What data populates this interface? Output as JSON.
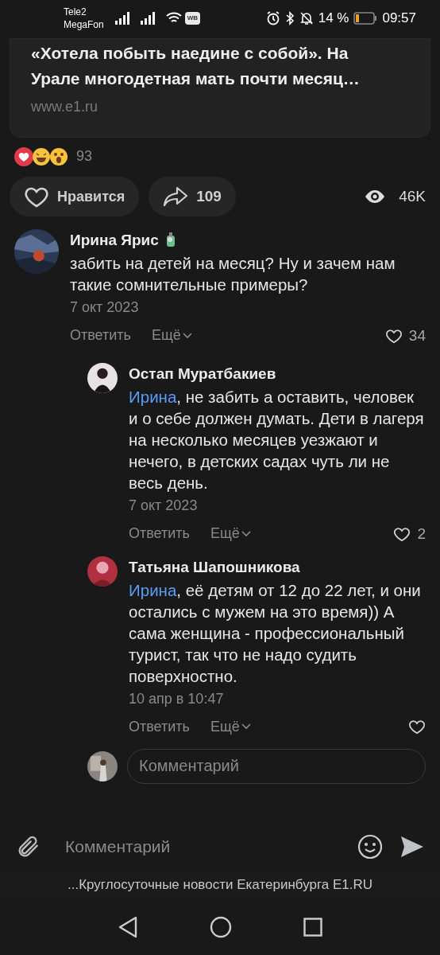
{
  "status_bar": {
    "carriers": [
      "Tele2",
      "MegaFon"
    ],
    "battery": "14 %",
    "time": "09:57",
    "wb_badge": "WB"
  },
  "link_card": {
    "title_lines": [
      "«Хотела побыть наедине с собой». На",
      "Урале многодетная мать почти месяц…"
    ],
    "url": "www.e1.ru"
  },
  "reactions": {
    "count": "93"
  },
  "actions": {
    "like_label": "Нравится",
    "liked": false,
    "shares": "109",
    "views": "46K"
  },
  "comments": [
    {
      "author": "Ирина Ярис",
      "has_badge": true,
      "text": "забить на детей на месяц? Ну и зачем нам такие сомнительные примеры?",
      "date": "7 окт 2023",
      "reply": "Ответить",
      "more": "Ещё",
      "likes": "34",
      "children": [
        {
          "author": "Остап Муратбакиев",
          "mention": "Ирина",
          "text": ", не забить а оставить, человек и о себе должен думать. Дети в лагеря на несколько месяцев уезжают и нечего, в детских садах чуть ли не весь день.",
          "date": "7 окт 2023",
          "reply": "Ответить",
          "more": "Ещё",
          "likes": "2"
        },
        {
          "author": "Татьяна Шапошникова",
          "mention": "Ирина",
          "text": ", её детям от 12 до 22 лет, и они остались с мужем на это время)) А сама женщина - профессиональный турист, так что не надо судить поверхностно.",
          "date": "10 апр в 10:47",
          "reply": "Ответить",
          "more": "Ещё"
        }
      ]
    }
  ],
  "reply_field": {
    "placeholder": "Комментарий"
  },
  "composer": {
    "placeholder": "Комментарий"
  },
  "footer": {
    "site_title": "...Круглосуточные новости Екатеринбурга E1.RU"
  }
}
